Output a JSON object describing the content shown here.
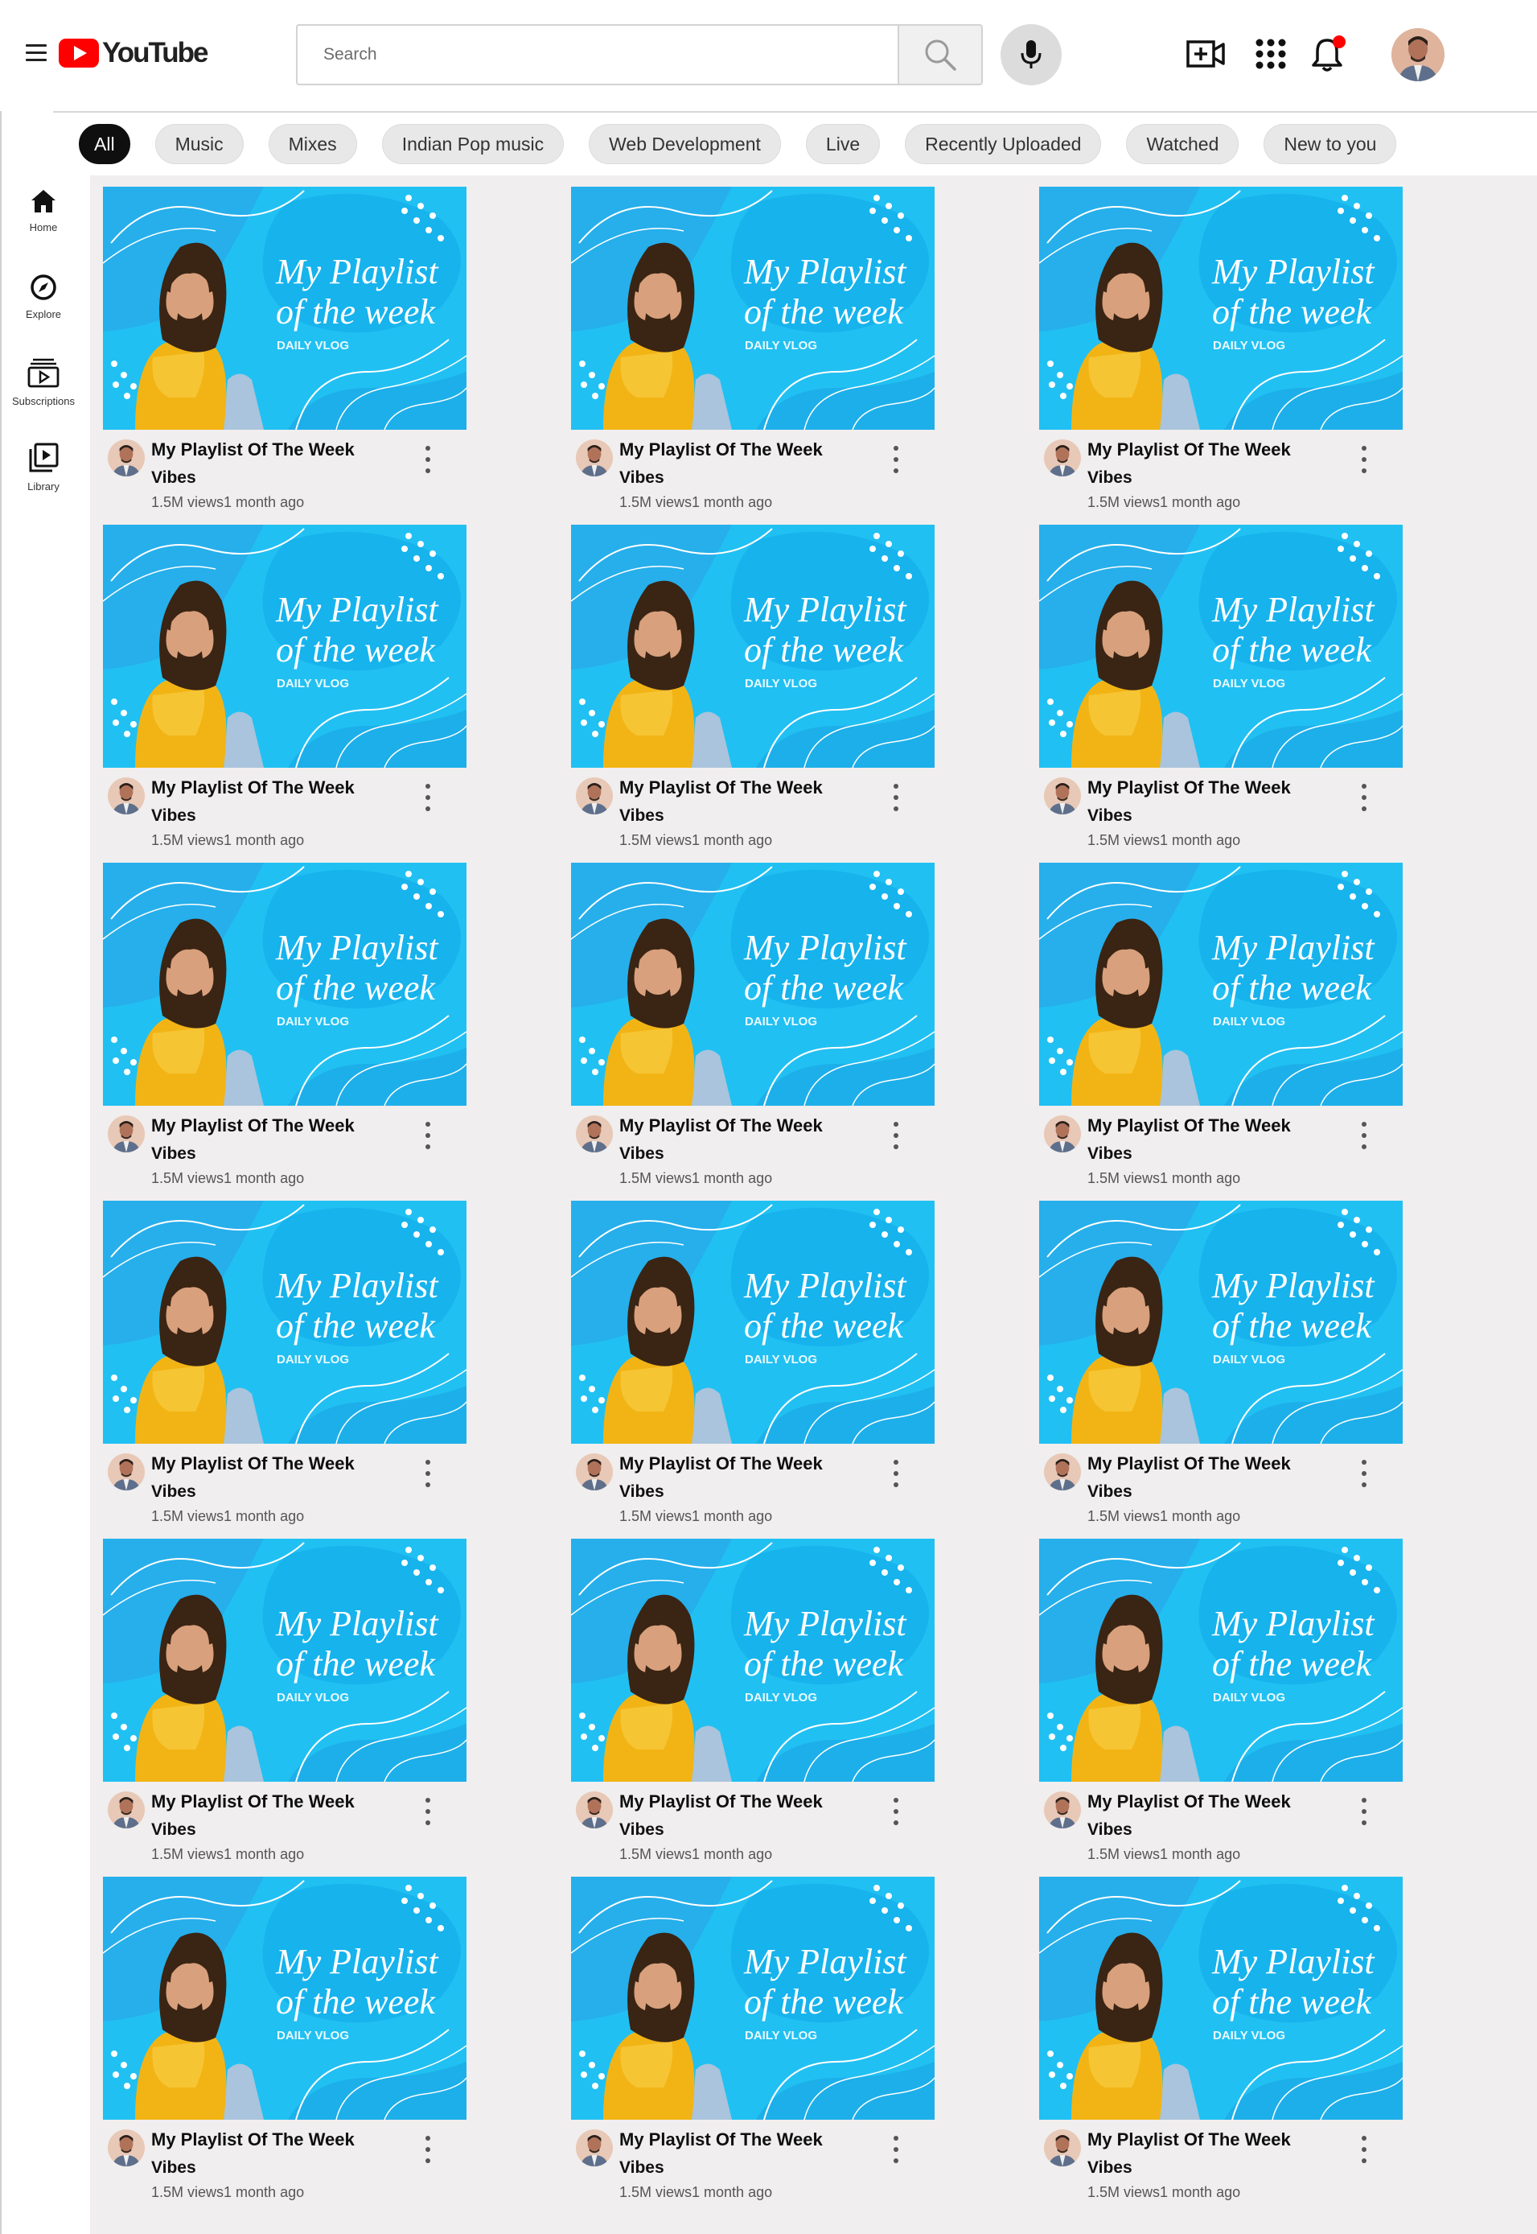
{
  "header": {
    "logo_text": "YouTube",
    "search_placeholder": "Search"
  },
  "chips": [
    "All",
    "Music",
    "Mixes",
    "Indian Pop music",
    "Web Development",
    "Live",
    "Recently Uploaded",
    "Watched",
    "New to you"
  ],
  "active_chip": "All",
  "sidebar": {
    "items": [
      {
        "label": "Home",
        "icon": "home-icon"
      },
      {
        "label": "Explore",
        "icon": "compass-icon"
      },
      {
        "label": "Subscriptions",
        "icon": "subscriptions-icon"
      },
      {
        "label": "Library",
        "icon": "library-icon"
      }
    ]
  },
  "thumbnail": {
    "line1": "My Playlist",
    "line2": "of the week",
    "tag": "DAILY VLOG"
  },
  "colors": {
    "brand_red": "#ff0000",
    "thumb_blue": "#1fb4ee",
    "feed_bg": "#f0eeee"
  },
  "videos": [
    {
      "title": "My Playlist Of The Week",
      "channel": "Vibes",
      "views": "1.5M views",
      "age": "1 month ago"
    },
    {
      "title": "My Playlist Of The Week",
      "channel": "Vibes",
      "views": "1.5M views",
      "age": "1 month ago"
    },
    {
      "title": "My Playlist Of The Week",
      "channel": "Vibes",
      "views": "1.5M views",
      "age": "1 month ago"
    },
    {
      "title": "My Playlist Of The Week",
      "channel": "Vibes",
      "views": "1.5M views",
      "age": "1 month ago"
    },
    {
      "title": "My Playlist Of The Week",
      "channel": "Vibes",
      "views": "1.5M views",
      "age": "1 month ago"
    },
    {
      "title": "My Playlist Of The Week",
      "channel": "Vibes",
      "views": "1.5M views",
      "age": "1 month ago"
    },
    {
      "title": "My Playlist Of The Week",
      "channel": "Vibes",
      "views": "1.5M views",
      "age": "1 month ago"
    },
    {
      "title": "My Playlist Of The Week",
      "channel": "Vibes",
      "views": "1.5M views",
      "age": "1 month ago"
    },
    {
      "title": "My Playlist Of The Week",
      "channel": "Vibes",
      "views": "1.5M views",
      "age": "1 month ago"
    },
    {
      "title": "My Playlist Of The Week",
      "channel": "Vibes",
      "views": "1.5M views",
      "age": "1 month ago"
    },
    {
      "title": "My Playlist Of The Week",
      "channel": "Vibes",
      "views": "1.5M views",
      "age": "1 month ago"
    },
    {
      "title": "My Playlist Of The Week",
      "channel": "Vibes",
      "views": "1.5M views",
      "age": "1 month ago"
    },
    {
      "title": "My Playlist Of The Week",
      "channel": "Vibes",
      "views": "1.5M views",
      "age": "1 month ago"
    },
    {
      "title": "My Playlist Of The Week",
      "channel": "Vibes",
      "views": "1.5M views",
      "age": "1 month ago"
    },
    {
      "title": "My Playlist Of The Week",
      "channel": "Vibes",
      "views": "1.5M views",
      "age": "1 month ago"
    },
    {
      "title": "My Playlist Of The Week",
      "channel": "Vibes",
      "views": "1.5M views",
      "age": "1 month ago"
    },
    {
      "title": "My Playlist Of The Week",
      "channel": "Vibes",
      "views": "1.5M views",
      "age": "1 month ago"
    },
    {
      "title": "My Playlist Of The Week",
      "channel": "Vibes",
      "views": "1.5M views",
      "age": "1 month ago"
    }
  ]
}
